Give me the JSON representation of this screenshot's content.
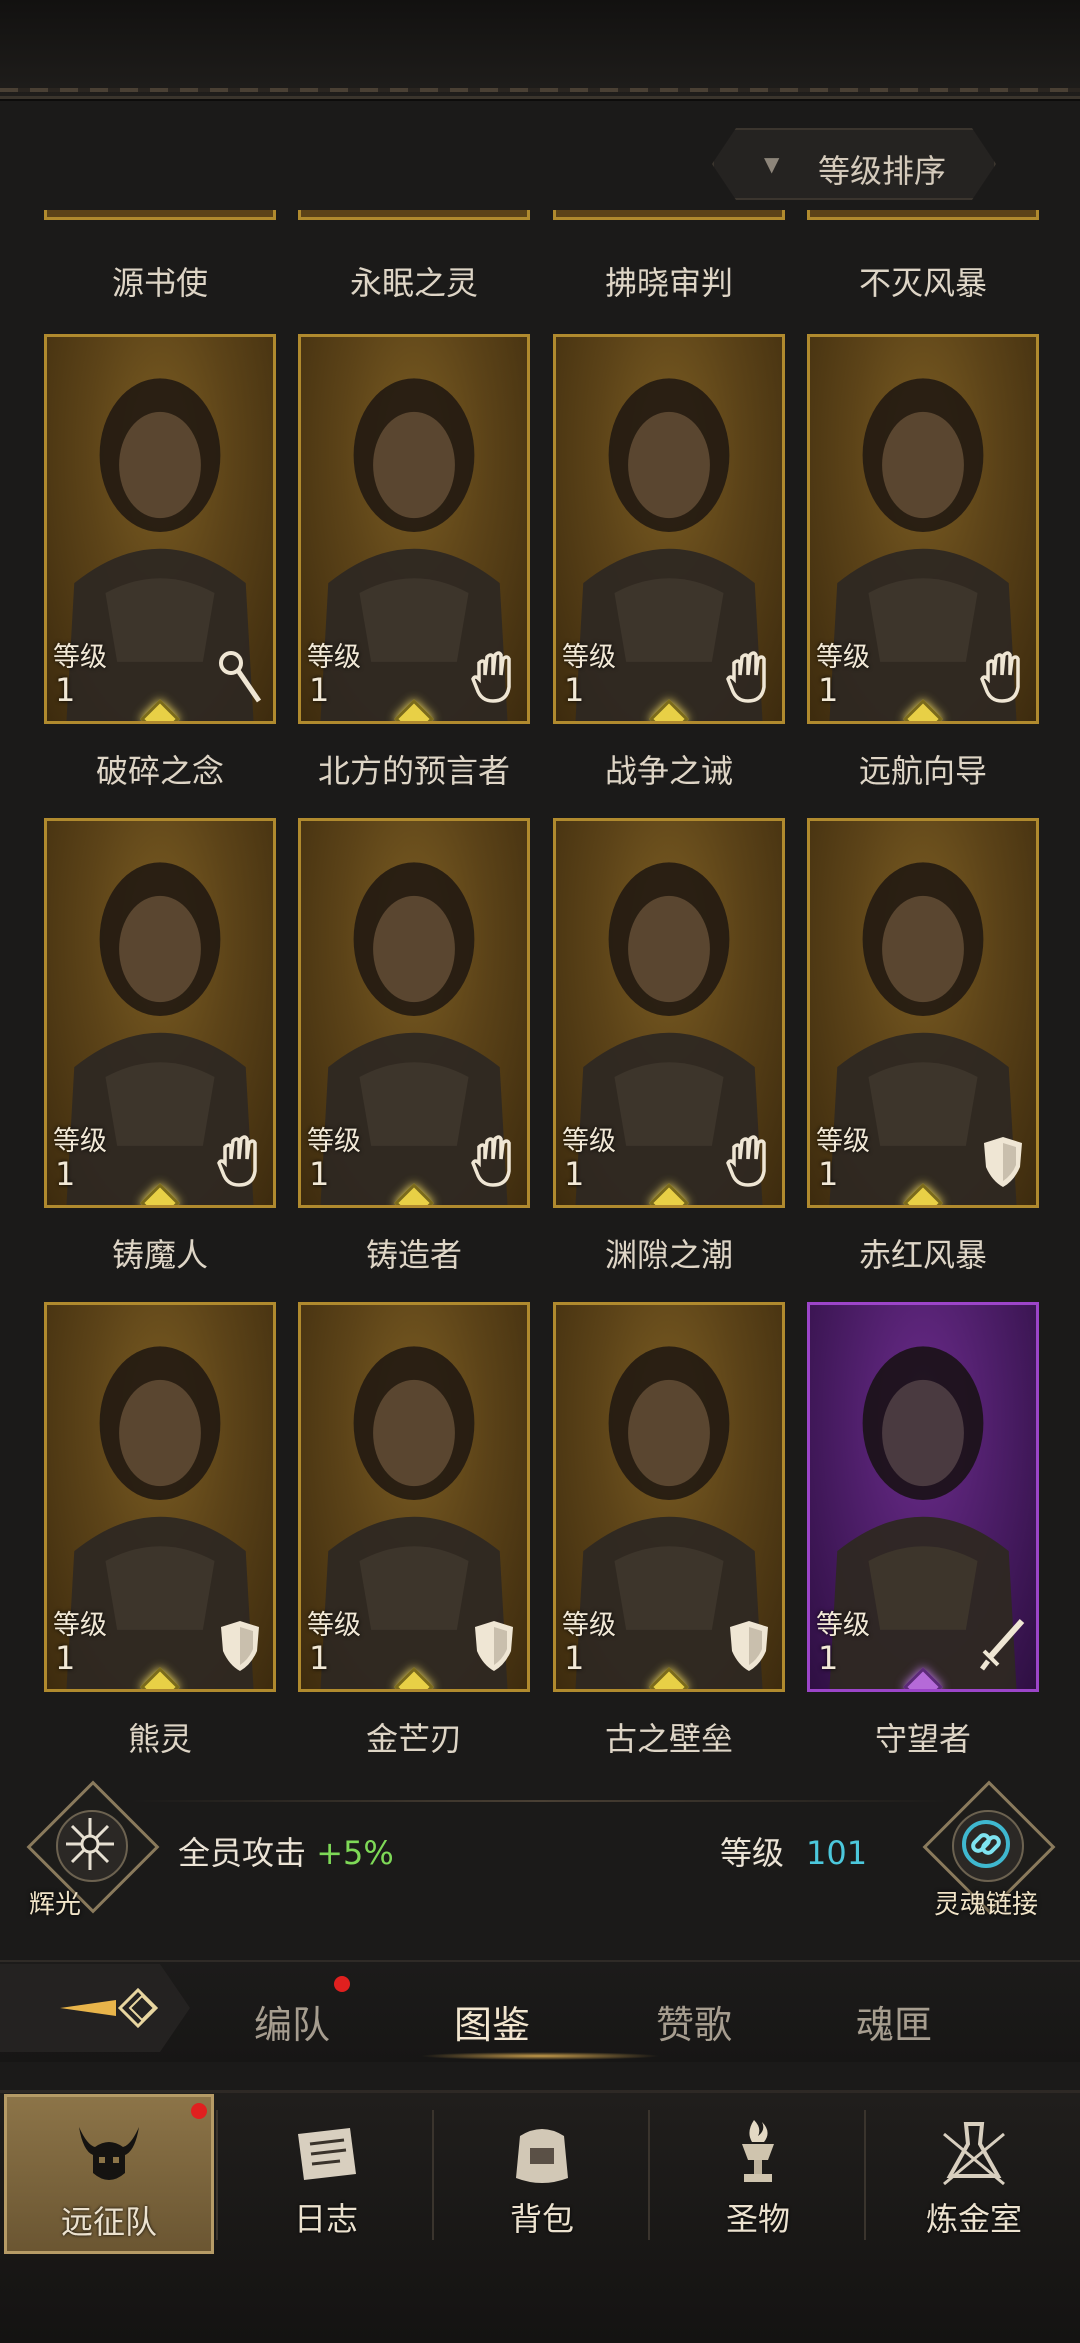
{
  "sort": {
    "label": "等级排序"
  },
  "row0_names": [
    "源书使",
    "永眠之灵",
    "拂晓审判",
    "不灭风暴"
  ],
  "heroes": [
    {
      "name": "破碎之念",
      "level_label": "等级",
      "level": "1",
      "class_icon": "staff-icon",
      "rarity": "gold"
    },
    {
      "name": "北方的预言者",
      "level_label": "等级",
      "level": "1",
      "class_icon": "hand-icon",
      "rarity": "gold"
    },
    {
      "name": "战争之诫",
      "level_label": "等级",
      "level": "1",
      "class_icon": "hand-icon",
      "rarity": "gold"
    },
    {
      "name": "远航向导",
      "level_label": "等级",
      "level": "1",
      "class_icon": "hand-icon",
      "rarity": "gold"
    },
    {
      "name": "铸魔人",
      "level_label": "等级",
      "level": "1",
      "class_icon": "fist-icon",
      "rarity": "gold"
    },
    {
      "name": "铸造者",
      "level_label": "等级",
      "level": "1",
      "class_icon": "fist-icon",
      "rarity": "gold"
    },
    {
      "name": "渊隙之潮",
      "level_label": "等级",
      "level": "1",
      "class_icon": "fist-icon",
      "rarity": "gold"
    },
    {
      "name": "赤红风暴",
      "level_label": "等级",
      "level": "1",
      "class_icon": "shield-icon",
      "rarity": "gold"
    },
    {
      "name": "熊灵",
      "level_label": "等级",
      "level": "1",
      "class_icon": "shield-icon",
      "rarity": "gold"
    },
    {
      "name": "金芒刃",
      "level_label": "等级",
      "level": "1",
      "class_icon": "shield-icon",
      "rarity": "gold"
    },
    {
      "name": "古之壁垒",
      "level_label": "等级",
      "level": "1",
      "class_icon": "shield-icon",
      "rarity": "gold"
    },
    {
      "name": "守望者",
      "level_label": "等级",
      "level": "1",
      "class_icon": "sword-icon",
      "rarity": "purple"
    }
  ],
  "bonus": {
    "left_emblem_label": "辉光",
    "text": "全员攻击",
    "value": "+5%",
    "level_label": "等级",
    "level_value": "101",
    "right_emblem_label": "灵魂链接"
  },
  "tabs": [
    "编队",
    "图鉴",
    "赞歌",
    "魂匣"
  ],
  "active_tab": "图鉴",
  "nav": [
    "远征队",
    "日志",
    "背包",
    "圣物",
    "炼金室"
  ],
  "colors": {
    "gold_border": "#b08a2e",
    "purple_border": "#9c45c9",
    "bonus_green": "#7ed957",
    "level_cyan": "#4cc8dc"
  }
}
